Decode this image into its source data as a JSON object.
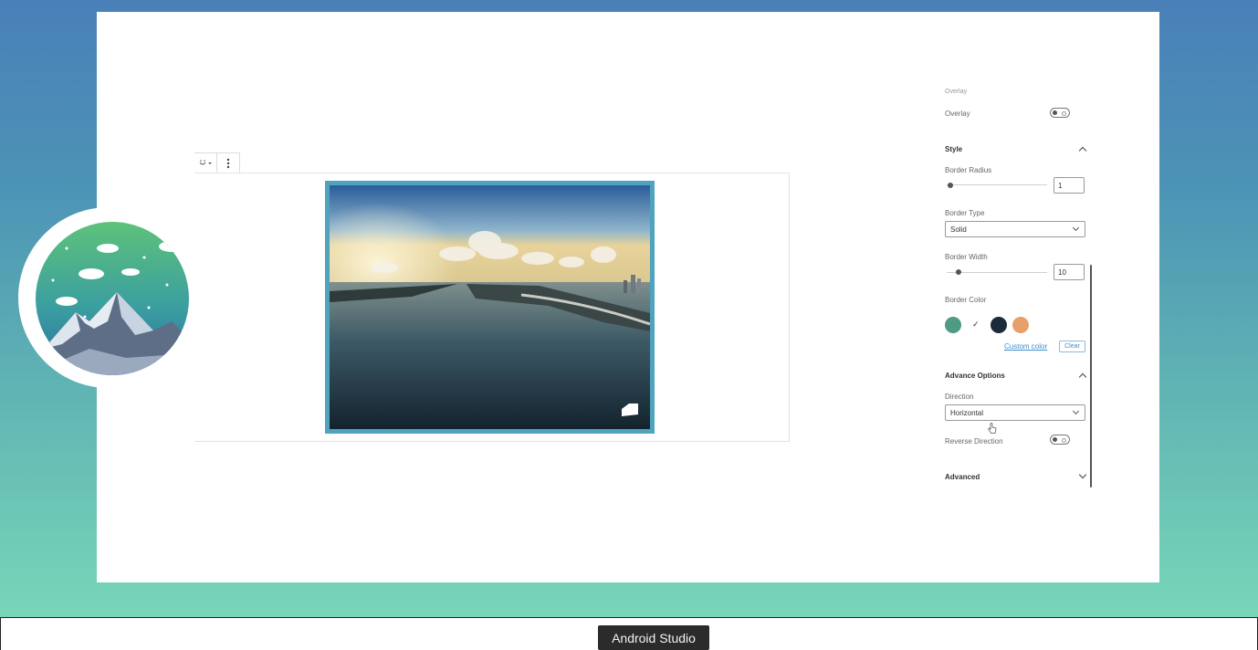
{
  "taskbar": {
    "app_tooltip": "Android Studio"
  },
  "block_toolbar": {
    "icon_emoji": "emoji-icon",
    "icon_more": "more-vertical-icon"
  },
  "sidebar": {
    "overlay_heading": "Overlay",
    "overlay_label": "Overlay",
    "overlay_enabled": false,
    "style_section": "Style",
    "border_radius_label": "Border Radius",
    "border_radius_value": "1",
    "border_type_label": "Border Type",
    "border_type_value": "Solid",
    "border_width_label": "Border Width",
    "border_width_value": "10",
    "border_color_label": "Border Color",
    "colors": [
      "#4f9a85",
      "#ffffff",
      "#1c2b3a",
      "#e7a06c"
    ],
    "selected_color_index": 1,
    "custom_color_link": "Custom color",
    "clear_button": "Clear",
    "advance_options_section": "Advance Options",
    "direction_label": "Direction",
    "direction_value": "Horizontal",
    "reverse_direction_label": "Reverse Direction",
    "reverse_direction_enabled": false,
    "advanced_section": "Advanced"
  },
  "image_block": {
    "border_color": "#4fa3bd",
    "subject": "aerial-city-bay-photo"
  }
}
